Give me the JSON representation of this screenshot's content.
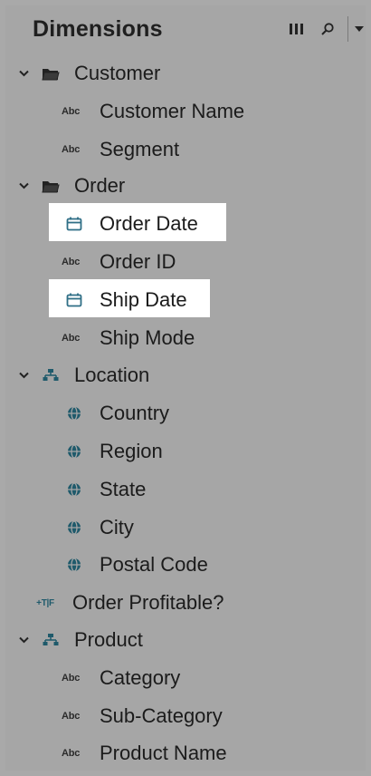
{
  "header": {
    "title": "Dimensions",
    "icons": [
      "columns-icon",
      "search-icon",
      "dropdown-icon"
    ]
  },
  "tree": {
    "customer": {
      "label": "Customer",
      "items": [
        "Customer Name",
        "Segment"
      ]
    },
    "order": {
      "label": "Order",
      "items": [
        "Order Date",
        "Order ID",
        "Ship Date",
        "Ship Mode"
      ]
    },
    "location": {
      "label": "Location",
      "items": [
        "Country",
        "Region",
        "State",
        "City",
        "Postal Code"
      ]
    },
    "order_profitable": {
      "label": "Order Profitable?",
      "type_badge": "+T|F"
    },
    "product": {
      "label": "Product",
      "items": [
        "Category",
        "Sub-Category",
        "Product Name"
      ]
    },
    "abc_badge": "Abc"
  },
  "colors": {
    "background": "#a6a6a6",
    "highlight": "#ffffff",
    "date_icon": "#2f6f86",
    "geo_icon": "#1f5a6b"
  }
}
